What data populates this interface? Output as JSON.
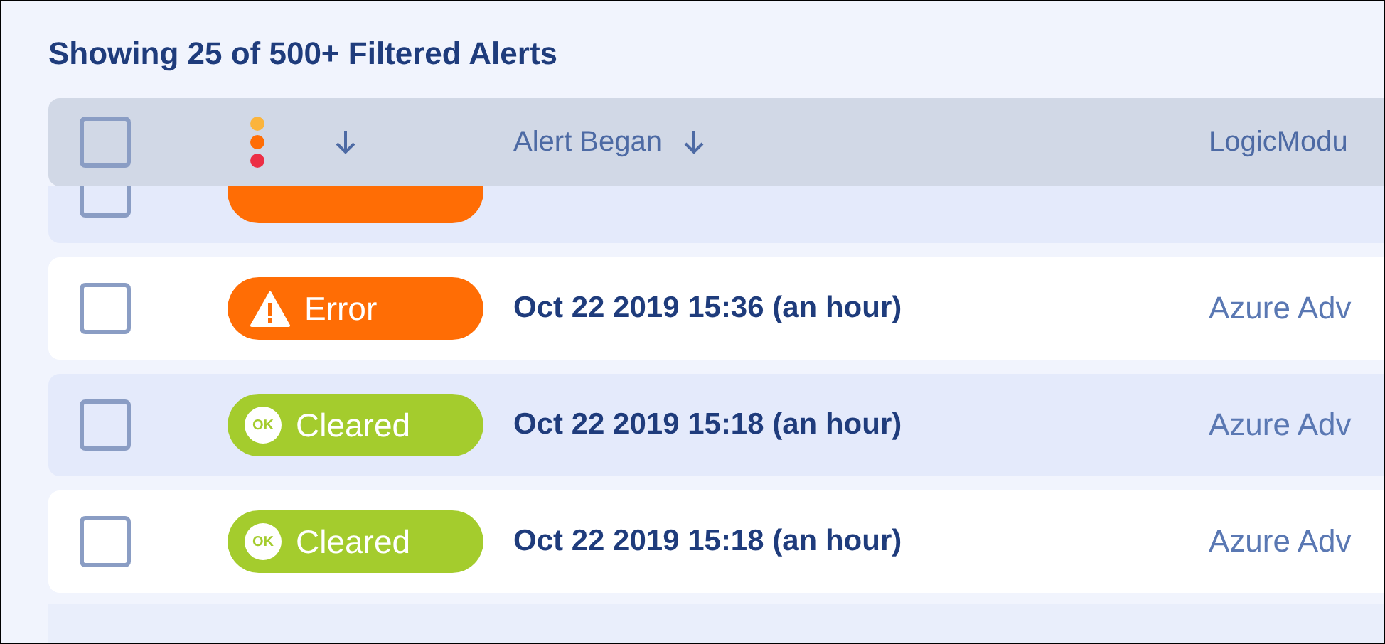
{
  "title": "Showing 25 of 500+ Filtered Alerts",
  "header": {
    "select_all": {
      "checked": false
    },
    "columns": [
      {
        "kind": "severity"
      },
      {
        "kind": "text",
        "label": "Alert Began"
      },
      {
        "kind": "text",
        "label": "LogicModu"
      }
    ]
  },
  "rows": [
    {
      "kind": "partial",
      "checked": false,
      "status": {
        "kind": "error"
      }
    },
    {
      "kind": "full",
      "checked": false,
      "status": {
        "kind": "error",
        "label": "Error"
      },
      "began": "Oct 22 2019 15:36 (an hour)",
      "logic_module": "Azure Adv"
    },
    {
      "kind": "full",
      "checked": false,
      "status": {
        "kind": "cleared",
        "label": "Cleared",
        "icon_text": "OK"
      },
      "began": "Oct 22 2019 15:18 (an hour)",
      "logic_module": "Azure Adv"
    },
    {
      "kind": "full",
      "checked": false,
      "status": {
        "kind": "cleared",
        "label": "Cleared",
        "icon_text": "OK"
      },
      "began": "Oct 22 2019 15:18 (an hour)",
      "logic_module": "Azure Adv"
    }
  ]
}
